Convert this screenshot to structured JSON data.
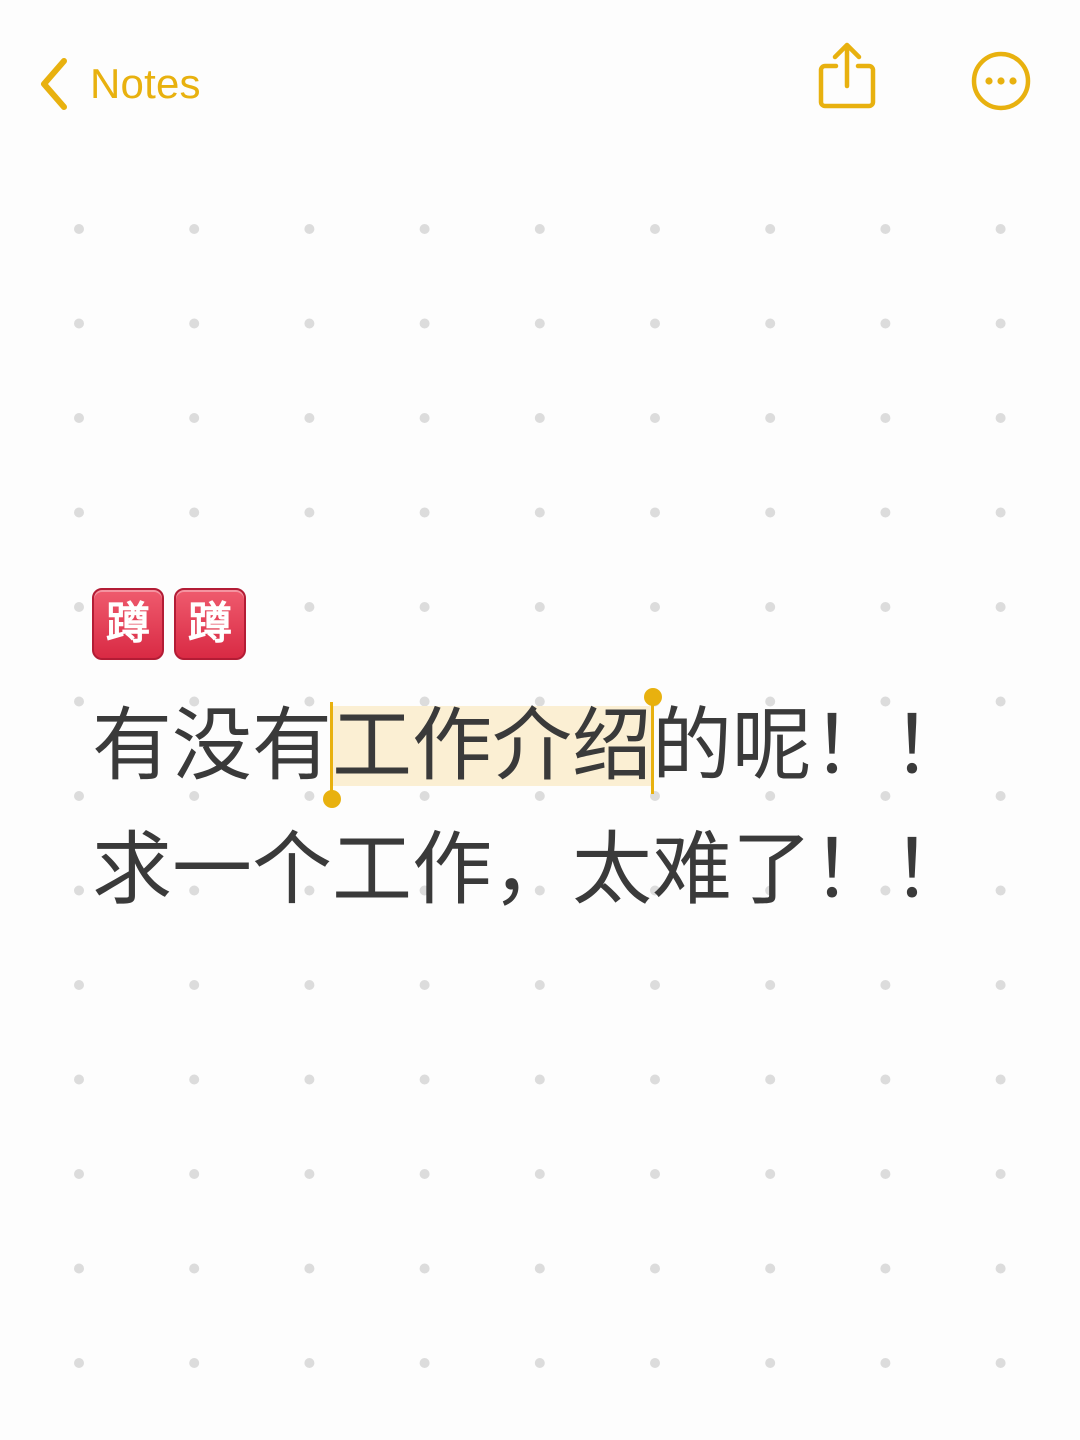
{
  "colors": {
    "accent": "#e8b10f",
    "background": "#fdfdfd",
    "text": "#3a3a3a",
    "selection": "#fbefd3",
    "grid_dot": "#dcdcdc",
    "emoji_tile": "#e0364f"
  },
  "nav": {
    "back_label": "Notes",
    "back_icon": "chevron-left-icon",
    "share_icon": "share-icon",
    "more_icon": "ellipsis-circle-icon"
  },
  "note": {
    "emojis": [
      "蹲",
      "蹲"
    ],
    "line1": {
      "before": "有没有",
      "selected": "工作介绍",
      "after": "的呢！！"
    },
    "line2": "求一个工作，太难了！！"
  }
}
